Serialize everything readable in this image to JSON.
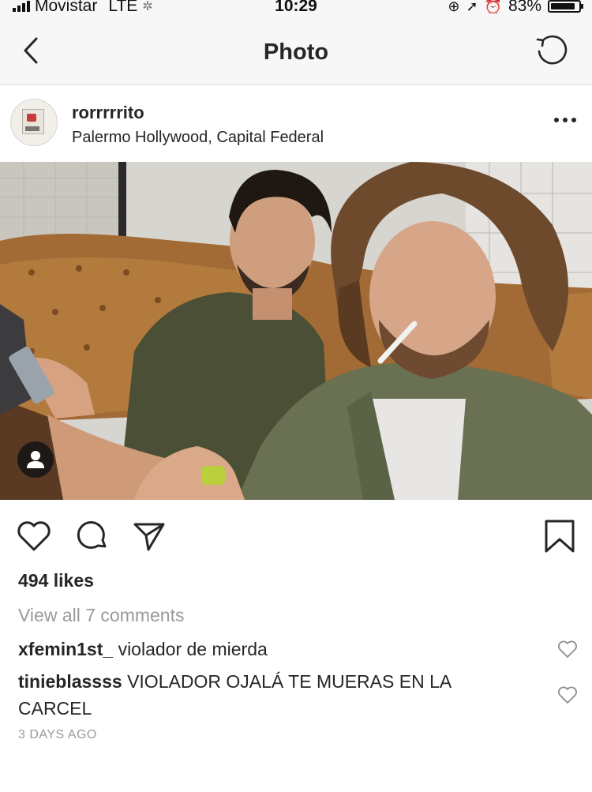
{
  "status_bar": {
    "carrier": "Movistar",
    "network": "LTE",
    "time": "10:29",
    "battery": "83%"
  },
  "nav": {
    "title": "Photo",
    "back_icon": "chevron-left-icon",
    "refresh_icon": "refresh-icon"
  },
  "post": {
    "username": "rorrrrrito",
    "location": "Palermo Hollywood, Capital Federal",
    "more_icon": "ellipsis-icon",
    "likes": "494 likes",
    "view_all": "View all 7 comments",
    "comments": [
      {
        "user": "xfemin1st_",
        "text": "violador de mierda"
      },
      {
        "user": "tinieblassss",
        "text": "VIOLADOR OJALÁ TE MUERAS EN LA CARCEL"
      }
    ],
    "time_ago": "3 DAYS AGO"
  },
  "colors": {
    "bar_bg": "#f7f7f7",
    "text": "#262626",
    "muted": "#9a9a9a"
  }
}
